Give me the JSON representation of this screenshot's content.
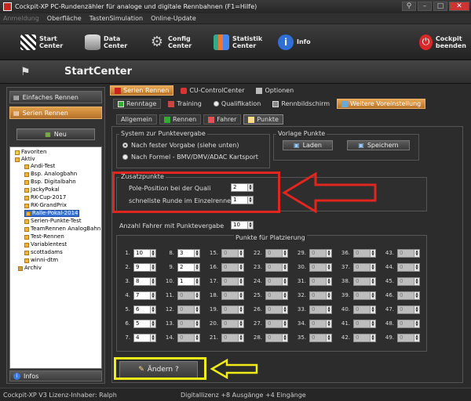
{
  "window": {
    "title": "Cockpit-XP PC-Rundenzähler für analoge und digitale Rennbahnen (F1=Hilfe)"
  },
  "menu": [
    "Anmeldung",
    "Oberfläche",
    "TastenSimulation",
    "Online-Update"
  ],
  "toolbar": {
    "start": [
      "Start",
      "Center"
    ],
    "data": [
      "Data",
      "Center"
    ],
    "config": [
      "Config",
      "Center"
    ],
    "stats": [
      "Statistik",
      "Center"
    ],
    "info": "Info",
    "quit": [
      "Cockpit",
      "beenden"
    ]
  },
  "header": {
    "title": "StartCenter"
  },
  "sidebar": {
    "einfaches": "Einfaches Rennen",
    "serien": "Serien Rennen",
    "neu": "Neu",
    "tree": [
      "Favoriten",
      "Aktiv",
      "Andi-Test",
      "Bsp. Analogbahn",
      "Bsp. Digitalbahn",
      "JackyPokal",
      "RK-Cup-2017",
      "RK-GrandPrix",
      "Ralle-Pokal-2014",
      "Serien-Punkte-Test",
      "TeamRennen AnalogBahn",
      "Test-Rennen",
      "Variablentest",
      "scottadams",
      "winni-dtm",
      "Archiv"
    ],
    "infos": "Infos"
  },
  "tabs1": [
    "Serien Rennen",
    "CU-ControlCenter",
    "Optionen"
  ],
  "tabs2": [
    "Renntage",
    "Training",
    "Qualifikation",
    "Rennbildschirm",
    "Weitere Voreinstellung"
  ],
  "tabs3": [
    "Allgemein",
    "Rennen",
    "Fahrer",
    "Punkte"
  ],
  "system": {
    "title": "System zur Punktevergabe",
    "opt1": "Nach fester Vorgabe (siehe unten)",
    "opt2": "Nach Formel - BMV/DMV/ADAC Kartsport"
  },
  "vorlage": {
    "title": "Vorlage Punkte",
    "laden": "Laden",
    "speichern": "Speichern"
  },
  "zusatz": {
    "title": "Zusatzpunkte",
    "pole_label": "Pole-Position bei der Quali",
    "pole_value": "2",
    "fastest_label": "schnellste Runde im Einzelrennen",
    "fastest_value": "1"
  },
  "anzahl": {
    "label": "Anzahl Fahrer mit Punktevergabe",
    "value": "10"
  },
  "punkte_title": "Punkte für Platzierung",
  "points": {
    "c1": [
      [
        "1.",
        "10"
      ],
      [
        "2.",
        "9"
      ],
      [
        "3.",
        "8"
      ],
      [
        "4.",
        "7"
      ],
      [
        "5.",
        "6"
      ],
      [
        "6.",
        "5"
      ],
      [
        "7.",
        "4"
      ]
    ],
    "c2": [
      [
        "8.",
        "3"
      ],
      [
        "9.",
        "2"
      ],
      [
        "10.",
        "1"
      ],
      [
        "11.",
        "0"
      ],
      [
        "12.",
        "0"
      ],
      [
        "13.",
        "0"
      ],
      [
        "14.",
        "0"
      ]
    ],
    "c3": [
      [
        "15.",
        "0"
      ],
      [
        "16.",
        "0"
      ],
      [
        "17.",
        "0"
      ],
      [
        "18.",
        "0"
      ],
      [
        "19.",
        "0"
      ],
      [
        "20.",
        "0"
      ],
      [
        "21.",
        "0"
      ]
    ],
    "c4": [
      [
        "22.",
        "0"
      ],
      [
        "23.",
        "0"
      ],
      [
        "24.",
        "0"
      ],
      [
        "25.",
        "0"
      ],
      [
        "26.",
        "0"
      ],
      [
        "27.",
        "0"
      ],
      [
        "28.",
        "0"
      ]
    ],
    "c5": [
      [
        "29.",
        "0"
      ],
      [
        "30.",
        "0"
      ],
      [
        "31.",
        "0"
      ],
      [
        "32.",
        "0"
      ],
      [
        "33.",
        "0"
      ],
      [
        "34.",
        "0"
      ],
      [
        "35.",
        "0"
      ]
    ],
    "c6": [
      [
        "36.",
        "0"
      ],
      [
        "37.",
        "0"
      ],
      [
        "38.",
        "0"
      ],
      [
        "39.",
        "0"
      ],
      [
        "40.",
        "0"
      ],
      [
        "41.",
        "0"
      ],
      [
        "42.",
        "0"
      ]
    ],
    "c7": [
      [
        "43.",
        "0"
      ],
      [
        "44.",
        "0"
      ],
      [
        "45.",
        "0"
      ],
      [
        "46.",
        "0"
      ],
      [
        "47.",
        "0"
      ],
      [
        "48.",
        "0"
      ],
      [
        "49.",
        "0"
      ]
    ]
  },
  "aendern": "Ändern ?",
  "status": {
    "left": "Cockpit-XP V3 Lizenz-Inhaber: Ralph",
    "right": "Digitallizenz  +8 Ausgänge +4 Eingänge"
  },
  "colors": {
    "accent": "#d28a36",
    "annotation_red": "#e0261e",
    "annotation_yellow": "#f0ec17"
  }
}
